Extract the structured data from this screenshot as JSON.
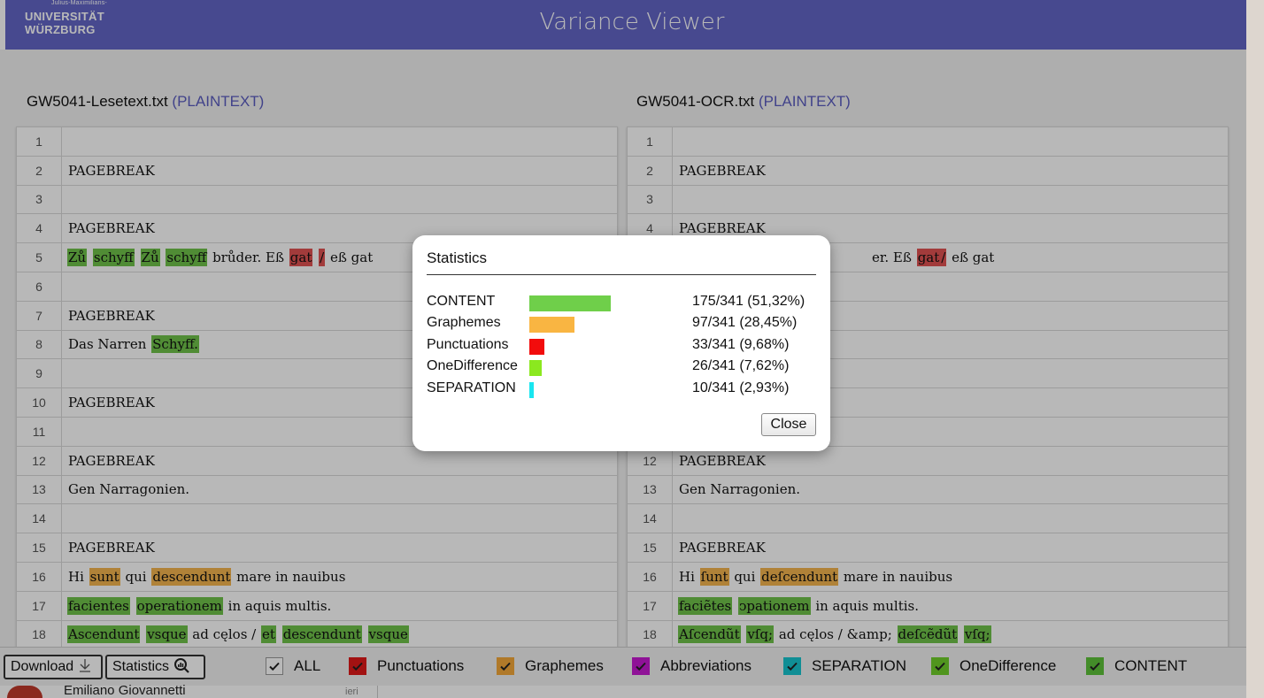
{
  "header": {
    "title": "Variance Viewer",
    "logo": {
      "small": "Julius-Maximilians-",
      "line1": "UNIVERSITÄT",
      "line2": "WÜRZBURG"
    }
  },
  "left_file": {
    "name": "GW5041-Lesetext.txt",
    "kind": "(PLAINTEXT)"
  },
  "right_file": {
    "name": "GW5041-OCR.txt",
    "kind": "(PLAINTEXT)"
  },
  "left_lines": [
    {
      "n": "1",
      "segs": []
    },
    {
      "n": "2",
      "segs": [
        {
          "t": "PAGEBREAK"
        }
      ]
    },
    {
      "n": "3",
      "segs": []
    },
    {
      "n": "4",
      "segs": [
        {
          "t": "PAGEBREAK"
        }
      ]
    },
    {
      "n": "5",
      "segs": [
        {
          "t": "Zů",
          "h": "green"
        },
        {
          "t": " "
        },
        {
          "t": "schyff",
          "h": "green"
        },
        {
          "t": " "
        },
        {
          "t": "Zů",
          "h": "green"
        },
        {
          "t": " "
        },
        {
          "t": "schyff",
          "h": "green"
        },
        {
          "t": " brůder. Eß "
        },
        {
          "t": "gat",
          "h": "red"
        },
        {
          "t": " "
        },
        {
          "t": "/",
          "h": "red"
        },
        {
          "t": " eß gat"
        }
      ]
    },
    {
      "n": "6",
      "segs": []
    },
    {
      "n": "7",
      "segs": [
        {
          "t": "PAGEBREAK"
        }
      ]
    },
    {
      "n": "8",
      "segs": [
        {
          "t": "Das Narren "
        },
        {
          "t": "Schyff.",
          "h": "green"
        }
      ]
    },
    {
      "n": "9",
      "segs": []
    },
    {
      "n": "10",
      "segs": [
        {
          "t": "PAGEBREAK"
        }
      ]
    },
    {
      "n": "11",
      "segs": []
    },
    {
      "n": "12",
      "segs": [
        {
          "t": "PAGEBREAK"
        }
      ]
    },
    {
      "n": "13",
      "segs": [
        {
          "t": "Gen Narragonien."
        }
      ]
    },
    {
      "n": "14",
      "segs": []
    },
    {
      "n": "15",
      "segs": [
        {
          "t": "PAGEBREAK"
        }
      ]
    },
    {
      "n": "16",
      "segs": [
        {
          "t": "Hi "
        },
        {
          "t": "sunt",
          "h": "orange"
        },
        {
          "t": " qui "
        },
        {
          "t": "descendunt",
          "h": "orange"
        },
        {
          "t": " mare in nauibus"
        }
      ]
    },
    {
      "n": "17",
      "segs": [
        {
          "t": "facientes",
          "h": "green"
        },
        {
          "t": " "
        },
        {
          "t": "operationem",
          "h": "green"
        },
        {
          "t": " in aquis multis."
        }
      ]
    },
    {
      "n": "18",
      "segs": [
        {
          "t": "Ascendunt",
          "h": "green"
        },
        {
          "t": " "
        },
        {
          "t": "vsque",
          "h": "green"
        },
        {
          "t": " ad cęlos / "
        },
        {
          "t": "et",
          "h": "green"
        },
        {
          "t": " "
        },
        {
          "t": "descendunt",
          "h": "green"
        },
        {
          "t": " "
        },
        {
          "t": "vsque",
          "h": "green"
        }
      ]
    }
  ],
  "right_lines": [
    {
      "n": "1",
      "segs": []
    },
    {
      "n": "2",
      "segs": [
        {
          "t": "PAGEBREAK"
        }
      ]
    },
    {
      "n": "3",
      "segs": []
    },
    {
      "n": "4",
      "segs": [
        {
          "t": "PAGEBREAK"
        }
      ]
    },
    {
      "n": "5",
      "segs": [
        {
          "t": ""
        }
      ]
    },
    {
      "n": "6",
      "segs": []
    },
    {
      "n": "7",
      "segs": []
    },
    {
      "n": "8",
      "segs": []
    },
    {
      "n": "9",
      "segs": []
    },
    {
      "n": "10",
      "segs": []
    },
    {
      "n": "11",
      "segs": []
    },
    {
      "n": "12",
      "segs": [
        {
          "t": "PAGEBREAK"
        }
      ]
    },
    {
      "n": "13",
      "segs": [
        {
          "t": "Gen Narragonien."
        }
      ]
    },
    {
      "n": "14",
      "segs": []
    },
    {
      "n": "15",
      "segs": [
        {
          "t": "PAGEBREAK"
        }
      ]
    },
    {
      "n": "16",
      "segs": [
        {
          "t": "Hi "
        },
        {
          "t": "ſunt",
          "h": "orange"
        },
        {
          "t": " qui "
        },
        {
          "t": "deſcendunt",
          "h": "orange"
        },
        {
          "t": " mare in nauibus"
        }
      ]
    },
    {
      "n": "17",
      "segs": [
        {
          "t": "faciẽtes",
          "h": "green"
        },
        {
          "t": " "
        },
        {
          "t": "ↄpationem",
          "h": "green"
        },
        {
          "t": " in aquis multis."
        }
      ]
    },
    {
      "n": "18",
      "segs": [
        {
          "t": "Aſcendũt",
          "h": "green"
        },
        {
          "t": " "
        },
        {
          "t": "vſq;",
          "h": "green"
        },
        {
          "t": " ad cęlos / &amp; "
        },
        {
          "t": "deſcẽdũt",
          "h": "green"
        },
        {
          "t": " "
        },
        {
          "t": "vſq;",
          "h": "green"
        }
      ]
    }
  ],
  "right_line5_visible": "er. Eß ",
  "right_line5_gat": "gat",
  "right_line5_slash": "/",
  "right_line5_tail": " eß gat",
  "modal": {
    "title": "Statistics",
    "close_label": "Close",
    "stats": [
      {
        "name": "CONTENT",
        "value": "175/341 (51,32%)",
        "fraction": 0.5132,
        "color": "#6fcf4a"
      },
      {
        "name": "Graphemes",
        "value": "97/341 (28,45%)",
        "fraction": 0.2845,
        "color": "#f9b542"
      },
      {
        "name": "Punctuations",
        "value": "33/341 (9,68%)",
        "fraction": 0.0968,
        "color": "#f20c0c"
      },
      {
        "name": "OneDifference",
        "value": "26/341 (7,62%)",
        "fraction": 0.0762,
        "color": "#8be81f"
      },
      {
        "name": "SEPARATION",
        "value": "10/341 (2,93%)",
        "fraction": 0.0293,
        "color": "#19e6f0"
      }
    ]
  },
  "bottombar": {
    "download_label": "Download",
    "statistics_label": "Statistics",
    "filters": [
      {
        "label": "ALL",
        "color": "#ffffff",
        "checked": true
      },
      {
        "label": "Punctuations",
        "color": "#e11919",
        "checked": true
      },
      {
        "label": "Graphemes",
        "color": "#f4a83a",
        "checked": true
      },
      {
        "label": "Abbreviations",
        "color": "#c71ad1",
        "checked": true
      },
      {
        "label": "SEPARATION",
        "color": "#17c5cf",
        "checked": true
      },
      {
        "label": "OneDifference",
        "color": "#6fcf2a",
        "checked": true
      },
      {
        "label": "CONTENT",
        "color": "#5ec23a",
        "checked": true
      }
    ]
  },
  "underlying": {
    "name": "Emiliano Giovannetti",
    "when": "ieri"
  }
}
